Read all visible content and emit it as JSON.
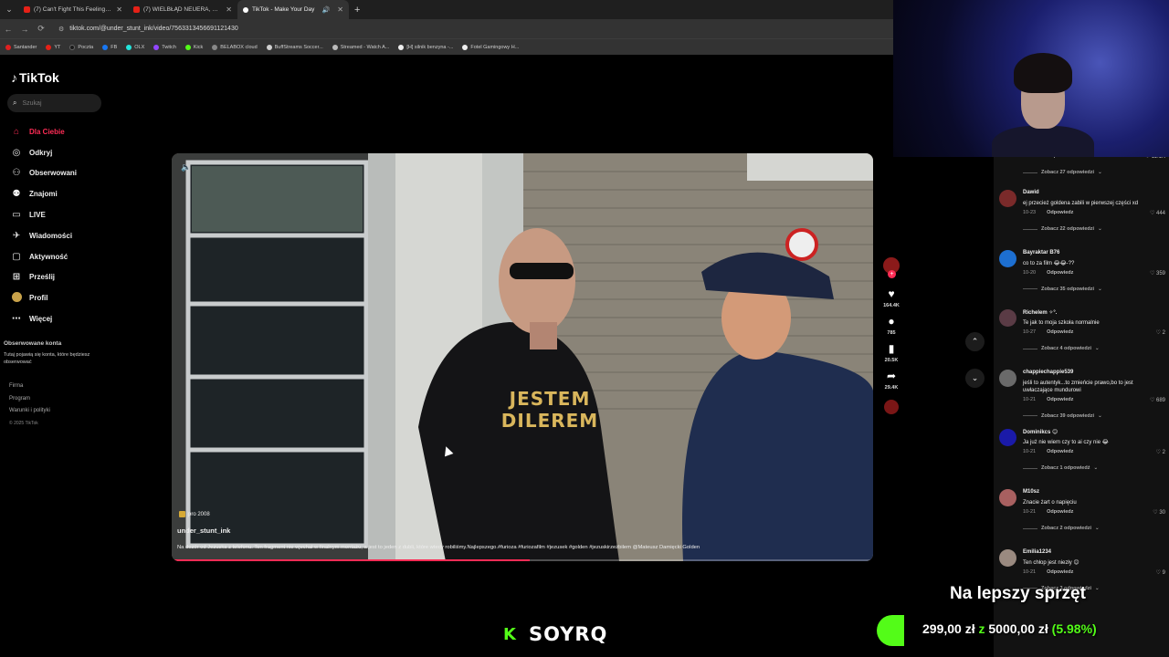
{
  "browser": {
    "tabs": [
      {
        "title": "(7) Can't Fight This Feeling - Yo",
        "icon": "youtube-icon"
      },
      {
        "title": "(7) WIELBŁĄD NEUERA, GOL W",
        "icon": "youtube-icon"
      },
      {
        "title": "TikTok - Make Your Day",
        "icon": "tiktok-icon",
        "active": true
      }
    ],
    "url": "tiktok.com/@under_stunt_ink/video/7563313456691121430",
    "bookmarks": [
      "Santander",
      "YT",
      "Poczta",
      "FB",
      "OLX",
      "Twitch",
      "Kick",
      "BELABOX cloud",
      "BuffStreams Soccer...",
      "Streamed - Watch A...",
      "[H] silnik benzyna -...",
      "Fotel Gamingowy H..."
    ]
  },
  "tiktok": {
    "logo": "TikTok",
    "search_placeholder": "Szukaj",
    "nav": [
      {
        "label": "Dla Ciebie",
        "icon": "home-icon",
        "active": true
      },
      {
        "label": "Odkryj",
        "icon": "compass-icon"
      },
      {
        "label": "Obserwowani",
        "icon": "user-follow-icon"
      },
      {
        "label": "Znajomi",
        "icon": "friends-icon"
      },
      {
        "label": "LIVE",
        "icon": "live-icon"
      },
      {
        "label": "Wiadomości",
        "icon": "message-icon"
      },
      {
        "label": "Aktywność",
        "icon": "activity-icon"
      },
      {
        "label": "Prześlij",
        "icon": "upload-icon"
      },
      {
        "label": "Profil",
        "icon": "profile-avatar-icon"
      },
      {
        "label": "Więcej",
        "icon": "more-icon"
      }
    ],
    "following_title": "Obserwowane konta",
    "following_desc": "Tutaj pojawią się konta, które będziesz obserwować",
    "footer": [
      "Firma",
      "Program",
      "Warunki i polityki",
      "© 2025 TikTok"
    ]
  },
  "video": {
    "badge": "pro 2008",
    "username": "under_stunt_ink",
    "description": "Na dozór od Jezuska z telefonu. Ten fragment nie wjechał w finalnym montażu, a jest to jeden z dubli, które wtedy robiliśmy.Najlepszego.#furioza #furiozafilm #jezusek #golden #jezuskirzeżbilem @Mateusz Damięcki Golden",
    "shirt_line1": "JESTEM",
    "shirt_line2": "DILEREM",
    "progress": 0.51,
    "likes": "164.4K",
    "comments": "785",
    "saves": "20.5K",
    "shares": "29.4K"
  },
  "comments": {
    "top_meta": {
      "date": "10-25",
      "reply": "Odpowiedz",
      "likes": "11.1K"
    },
    "top_more": "Zobacz 27 odpowiedzi",
    "items": [
      {
        "user": "Dawid",
        "text": "ej przecież goldena zabili w pierwszej części xd",
        "date": "10-23",
        "reply": "Odpowiedz",
        "likes": "444",
        "more": "Zobacz 22 odpowiedzi",
        "color": "#7a2a2a"
      },
      {
        "user": "Bayraktar B76",
        "text": "co to za film 😂😂-??",
        "date": "10-20",
        "reply": "Odpowiedz",
        "likes": "359",
        "more": "Zobacz 35 odpowiedzi",
        "color": "#1d6fd1"
      },
      {
        "user": "Richelem ✧°.",
        "text": "Te jak to moja szkoła normalnie",
        "date": "10-27",
        "reply": "Odpowiedz",
        "likes": "2",
        "more": "Zobacz 4 odpowiedzi",
        "color": "#5a3b45"
      },
      {
        "user": "chappiechappie539",
        "text": "jeśli to autentyk...to zmieńcie prawo,bo to jest uwłaczające mundurowi",
        "date": "10-21",
        "reply": "Odpowiedz",
        "likes": "689",
        "more": "Zobacz 39 odpowiedzi",
        "color": "#6a6a6a"
      },
      {
        "user": "Dominikcs 😊",
        "text": "Ja już nie wiem czy to ai czy nie 😂",
        "date": "10-21",
        "reply": "Odpowiedz",
        "likes": "2",
        "more": "Zobacz 1 odpowiedź",
        "color": "#1a1aa8"
      },
      {
        "user": "M10sz",
        "text": "Znacie żart o napięciu",
        "date": "10-21",
        "reply": "Odpowiedz",
        "likes": "30",
        "more": "Zobacz 2 odpowiedzi",
        "color": "#a86060"
      },
      {
        "user": "Emilia1234",
        "text": "Ten chłop jest niezły 😊",
        "date": "10-21",
        "reply": "Odpowiedz",
        "likes": "9",
        "more": "Zobacz 3 odpowiedzi",
        "color": "#9a8a80"
      }
    ]
  },
  "stream_overlay": {
    "goal_title": "Na lepszy sprzęt",
    "goal_current": "299,00 zł",
    "goal_separator": "z",
    "goal_target": "5000,00 zł",
    "goal_percent": "(5.98%)",
    "kick_logo": "K",
    "streamer": "SOYRQ"
  },
  "colors": {
    "tiktok_accent": "#fe2c55",
    "kick_green": "#53fc18"
  }
}
